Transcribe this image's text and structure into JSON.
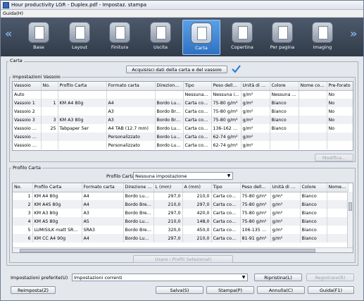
{
  "window": {
    "title": "Hour productivity LGR - Duplex.pdf - Impostaz. stampa"
  },
  "menu": {
    "items": [
      "Guida(H)"
    ]
  },
  "toolbar": {
    "items": [
      {
        "label": "Base"
      },
      {
        "label": "Layout"
      },
      {
        "label": "Finitura"
      },
      {
        "label": "Uscita"
      },
      {
        "label": "Carta"
      },
      {
        "label": "Copertina"
      },
      {
        "label": "Per pagina"
      },
      {
        "label": "Imaging"
      }
    ],
    "selected": "Carta"
  },
  "carta_group": {
    "label": "Carta",
    "acquire_button": "Acquisisci dati della carta e del vassoio"
  },
  "tray_group": {
    "label": "Impostazioni Vassoio",
    "columns": [
      "Vassoio",
      "No.",
      "Profilo Carta",
      "Formato carta",
      "Direzione ...",
      "Tipo",
      "Peso della...",
      "Unità di Mi...",
      "Colore",
      "Nome colore",
      "Pre-forato"
    ],
    "rows": [
      [
        "Auto",
        "",
        "",
        "",
        "",
        "Nessuna i...",
        "Nessuna i...",
        "g/m²",
        "Nessuna i...",
        "",
        "No"
      ],
      [
        "Vassoio 1",
        "1",
        "KM A4 80g",
        "A4",
        "Bordo Lungo",
        "Carta com...",
        "75-80 g/m²",
        "g/m²",
        "Bianco",
        "",
        "No"
      ],
      [
        "Vassoio 2",
        "",
        "",
        "A3",
        "Bordo Breve",
        "Carta com...",
        "75-80 g/m²",
        "g/m²",
        "Bianco",
        "",
        "No"
      ],
      [
        "Vassoio 3",
        "3",
        "KM A3 80g",
        "A3",
        "Bordo Breve",
        "Carta com...",
        "75-80 g/m²",
        "g/m²",
        "Bianco",
        "",
        "No"
      ],
      [
        "Vassoio b...",
        "25",
        "Tabpaper 5er",
        "A4 TAB (12.7 mm)",
        "Bordo Lungo",
        "Carta com...",
        "136-162 g...",
        "g/m²",
        "Bianco",
        "",
        "No"
      ],
      [
        "Vassoio 1 PI",
        "",
        "",
        "Personalizzato",
        "Bordo Lungo",
        "Carta com...",
        "62-74 g/m²",
        "g/m²",
        "",
        "",
        ""
      ],
      [
        "Vassoio 2 PI",
        "",
        "",
        "Personalizzato",
        "Bordo Lungo",
        "Carta com...",
        "62-74 g/m²",
        "g/m²",
        "",
        "",
        ""
      ]
    ],
    "modify_button": "Modifica..."
  },
  "profile_group": {
    "label": "Profilo Carta",
    "combo_label": "Profilo Carta",
    "combo_value": "Nessuna impostazione",
    "columns": [
      "No.",
      "Profilo Carta",
      "Formato carta",
      "Direzione di ...",
      "L (mm)",
      "A (mm)",
      "Tipo",
      "Peso della ...",
      "Unità di Mi...",
      "Colore",
      "Nome col..."
    ],
    "rows": [
      [
        "1",
        "KM A4 80g",
        "A4",
        "Bordo Lungo",
        "297,0",
        "210,0",
        "Carta com...",
        "75-80 g/m²",
        "g/m²",
        "Bianco",
        ""
      ],
      [
        "2",
        "KM A4S 80g",
        "A4",
        "Bordo Breve",
        "210,0",
        "297,0",
        "Carta com...",
        "75-80 g/m²",
        "g/m²",
        "Bianco",
        ""
      ],
      [
        "3",
        "KM A3 80g",
        "A3",
        "Bordo Breve",
        "297,0",
        "420,0",
        "Carta com...",
        "75-80 g/m²",
        "g/m²",
        "Bianco",
        ""
      ],
      [
        "4",
        "KM A5 80g",
        "A5",
        "Bordo Lungo",
        "210,0",
        "148,0",
        "Carta com...",
        "75-80 g/m²",
        "g/m²",
        "Bianco",
        ""
      ],
      [
        "5",
        "LUMISILK matt SRA3...",
        "SRA3",
        "Bordo Breve",
        "320,0",
        "450,0",
        "Carta com...",
        "106-135 g/m²",
        "g/m²",
        "Bianco",
        ""
      ],
      [
        "6",
        "KM CC A4 90g",
        "A4",
        "Bordo Lungo",
        "297,0",
        "210,0",
        "Carta com...",
        "81-91 g/m²",
        "g/m²",
        "Bianco",
        ""
      ]
    ],
    "use_button": "Usare i Profili Selezionati"
  },
  "footer": {
    "pref_label": "Impostazioni preferite(U)",
    "pref_value": "Impostazioni correnti",
    "restore_button": "Ripristina(L)",
    "register_button": "Registrare(R)",
    "reset_button": "Reimposta(Z)",
    "save_button": "Salva(S)",
    "print_button": "Stampa(P)",
    "cancel_button": "Annulla(C)",
    "help_button": "Guida(F1)"
  },
  "colors": {
    "accent": "#2f71c2",
    "check": "#2b7fd4"
  }
}
